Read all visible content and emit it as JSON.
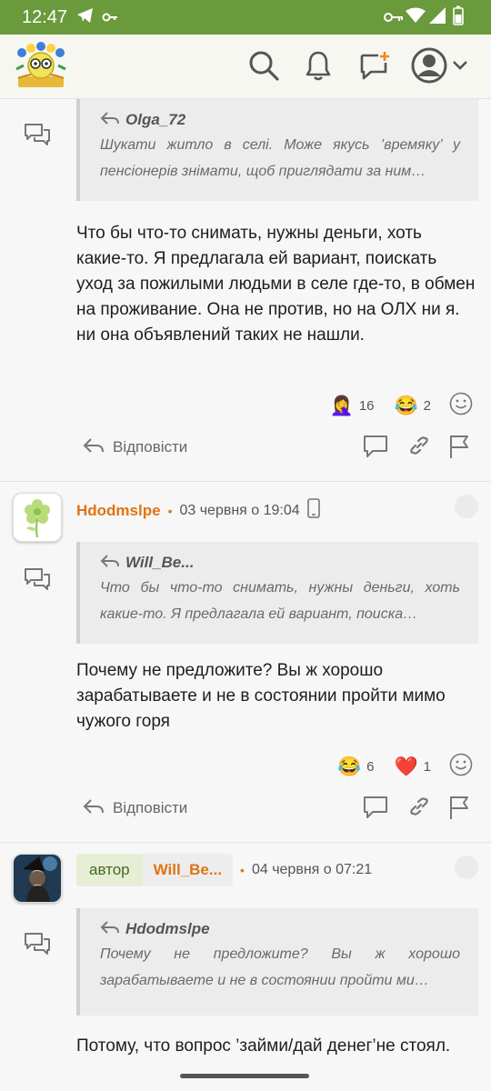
{
  "status": {
    "time": "12:47"
  },
  "header": {
    "logo": "site-logo",
    "icons": [
      "search-icon",
      "bell-icon",
      "new-message-icon",
      "account-icon",
      "chevron-down-icon"
    ]
  },
  "posts": [
    {
      "quote": {
        "author": "Olga_72",
        "text": "Шукати житло в селі. Може якусь ’времяку’ у пенсіонерів знімати, щоб приглядати за ним…"
      },
      "body": "Что бы что-то снимать, нужны деньги, хоть какие-то. Я предлагала ей вариант, поискать уход за пожилыми людьми в селе где-то, в обмен на проживание. Она не против, но на ОЛХ ни я. ни она объявлений таких не нашли.",
      "reactions": [
        {
          "emoji": "🤦‍♀️",
          "count": "16"
        },
        {
          "emoji": "😂",
          "count": "2"
        }
      ],
      "reply_label": "Відповісти"
    },
    {
      "author": "Hdodmslpe",
      "date": "03 червня о 19:04",
      "quote": {
        "author": "Will_Be...",
        "text": "Что бы что-то снимать, нужны деньги, хоть какие-то. Я предлагала ей вариант, поиска…"
      },
      "body": "Почему не предложите? Вы ж хорошо зарабатываете и не в состоянии пройти мимо чужого горя",
      "reactions": [
        {
          "emoji": "😂",
          "count": "6"
        },
        {
          "emoji": "❤️",
          "count": "1"
        }
      ],
      "reply_label": "Відповісти"
    },
    {
      "badge": "автор",
      "author": "Will_Be...",
      "date": "04 червня о 07:21",
      "quote": {
        "author": "Hdodmslpe",
        "text": "Почему не предложите? Вы ж хорошо зарабатываете и не в состоянии пройти ми…"
      },
      "body": "Потому, что вопрос ’займи/дай денег’не стоял."
    }
  ],
  "colors": {
    "statusbar": "#6a9a3c",
    "username": "#e07412",
    "author_badge_bg": "#e6eed6"
  }
}
